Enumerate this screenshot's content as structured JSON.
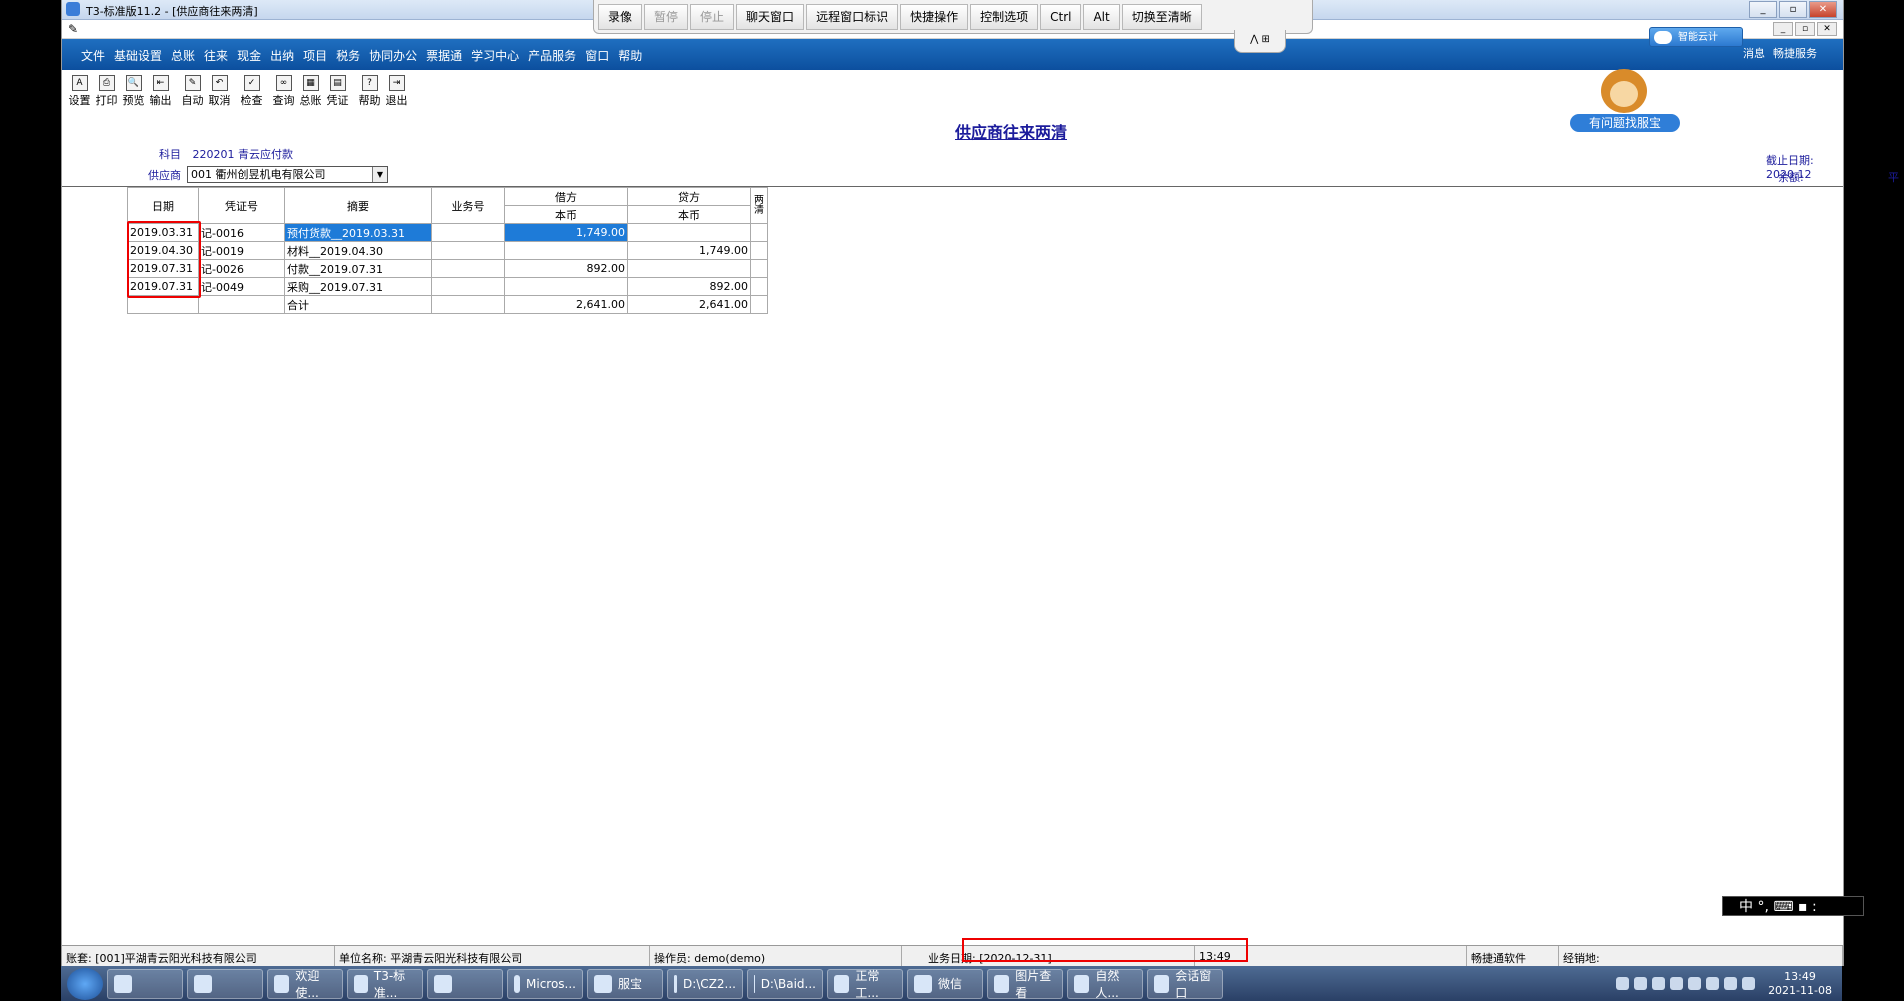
{
  "window": {
    "title": "T3-标准版11.2 - [供应商往来两清]",
    "min": "_",
    "max": "▫",
    "close": "✕"
  },
  "remote": {
    "buttons": [
      {
        "label": "录像",
        "disabled": false
      },
      {
        "label": "暂停",
        "disabled": true
      },
      {
        "label": "停止",
        "disabled": true
      },
      {
        "label": "聊天窗口",
        "disabled": false
      },
      {
        "label": "远程窗口标识",
        "disabled": false
      },
      {
        "label": "快捷操作",
        "disabled": false
      },
      {
        "label": "控制选项",
        "disabled": false
      },
      {
        "label": "Ctrl",
        "disabled": false
      },
      {
        "label": "Alt",
        "disabled": false
      },
      {
        "label": "切换至清晰",
        "disabled": false
      }
    ],
    "tab_glyph": "⋀ ⊞"
  },
  "menu": {
    "items": [
      "文件",
      "基础设置",
      "总账",
      "往来",
      "现金",
      "出纳",
      "项目",
      "税务",
      "协同办公",
      "票据通",
      "学习中心",
      "产品服务",
      "窗口",
      "帮助"
    ],
    "cloud_button": "智能云计",
    "right_links": [
      "消息",
      "畅捷服务"
    ]
  },
  "toolbar": [
    {
      "label": "设置",
      "icon": "settings-icon",
      "glyph": "A"
    },
    {
      "label": "打印",
      "icon": "print-icon",
      "glyph": "⎙"
    },
    {
      "label": "预览",
      "icon": "preview-icon",
      "glyph": "🔍"
    },
    {
      "label": "输出",
      "icon": "export-icon",
      "glyph": "⇤"
    },
    {
      "sep": true
    },
    {
      "label": "自动",
      "icon": "auto-icon",
      "glyph": "✎"
    },
    {
      "label": "取消",
      "icon": "undo-icon",
      "glyph": "↶"
    },
    {
      "sep": true
    },
    {
      "label": "检查",
      "icon": "check-icon",
      "glyph": "✓"
    },
    {
      "sep": true
    },
    {
      "label": "查询",
      "icon": "binoculars-icon",
      "glyph": "∞"
    },
    {
      "label": "总账",
      "icon": "ledger-icon",
      "glyph": "▦"
    },
    {
      "label": "凭证",
      "icon": "voucher-icon",
      "glyph": "▤"
    },
    {
      "sep": true
    },
    {
      "label": "帮助",
      "icon": "help-icon",
      "glyph": "?"
    },
    {
      "label": "退出",
      "icon": "exit-icon",
      "glyph": "⇥"
    }
  ],
  "mascot": {
    "label": "有问题找服宝"
  },
  "report": {
    "title": "供应商往来两清",
    "subject_label": "科目",
    "subject_code": "220201",
    "subject_name": "青云应付款",
    "supplier_label": "供应商",
    "supplier_value": "001  衢州创昱机电有限公司",
    "cutoff_label": "截止日期:",
    "cutoff_value": "2020.12",
    "balance_label": "余额:",
    "balance_value": "平"
  },
  "table": {
    "headers": {
      "date": "日期",
      "voucher": "凭证号",
      "summary": "摘要",
      "business": "业务号",
      "debit": "借方",
      "credit": "贷方",
      "debit_sub": "本币",
      "credit_sub": "本币",
      "cleared": "两清"
    },
    "rows": [
      {
        "date": "2019.03.31",
        "voucher": "记-0016",
        "summary": "预付货款__2019.03.31",
        "business": "",
        "debit": "1,749.00",
        "credit": "",
        "cleared": ""
      },
      {
        "date": "2019.04.30",
        "voucher": "记-0019",
        "summary": "材料__2019.04.30",
        "business": "",
        "debit": "",
        "credit": "1,749.00",
        "cleared": ""
      },
      {
        "date": "2019.07.31",
        "voucher": "记-0026",
        "summary": "付款__2019.07.31",
        "business": "",
        "debit": "892.00",
        "credit": "",
        "cleared": ""
      },
      {
        "date": "2019.07.31",
        "voucher": "记-0049",
        "summary": "采购__2019.07.31",
        "business": "",
        "debit": "",
        "credit": "892.00",
        "cleared": ""
      }
    ],
    "total": {
      "label": "合计",
      "debit": "2,641.00",
      "credit": "2,641.00"
    }
  },
  "ime": {
    "text": "中 °, ⌨ ▪ :"
  },
  "statusbar": {
    "account": "账套: [001]平湖青云阳光科技有限公司",
    "company": "单位名称: 平湖青云阳光科技有限公司",
    "operator": "操作员: demo(demo)",
    "business_date": "业务日期: [2020-12-31]",
    "time": "13:49",
    "vendor": "畅捷通软件",
    "distributor": "经销地:"
  },
  "taskbar": {
    "tasks": [
      "",
      "",
      "欢迎使...",
      "T3-标准...",
      "",
      "Micros...",
      "服宝",
      "D:\\CZ2...",
      "D:\\Baid...",
      "正常工...",
      "微信",
      "图片查看",
      "自然人...",
      "会话窗口"
    ],
    "clock_time": "13:49",
    "clock_date": "2021-11-08"
  }
}
